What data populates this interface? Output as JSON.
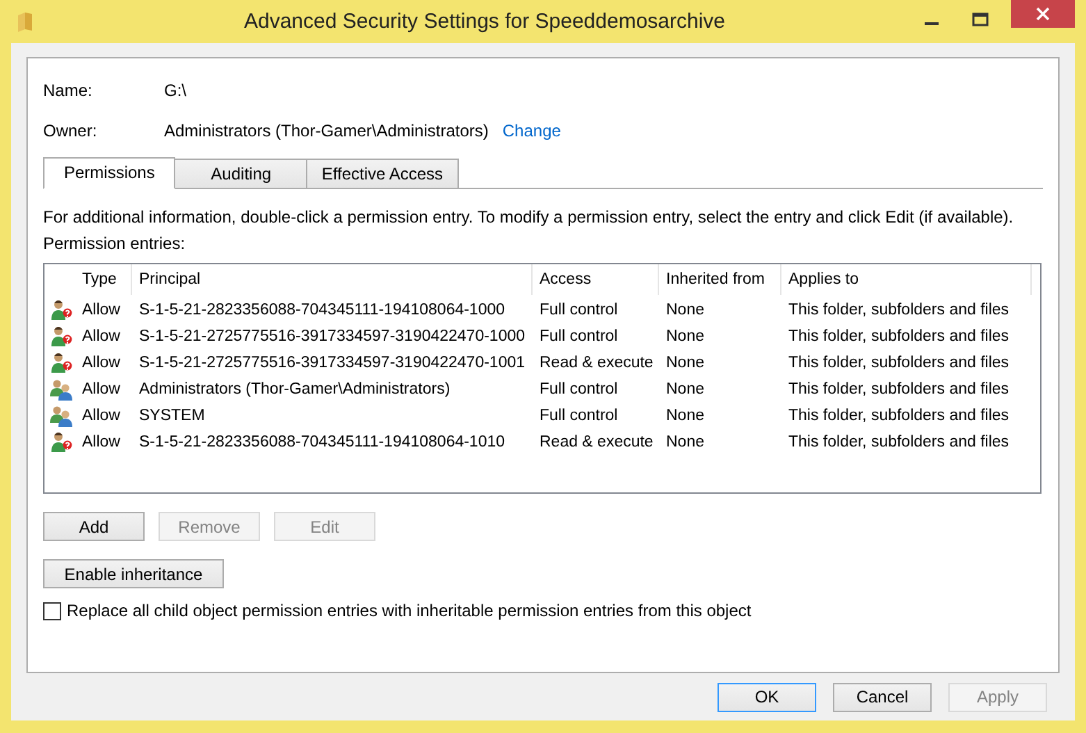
{
  "window": {
    "title": "Advanced Security Settings for Speeddemosarchive"
  },
  "name": {
    "label": "Name:",
    "value": "G:\\"
  },
  "owner": {
    "label": "Owner:",
    "value": "Administrators (Thor-Gamer\\Administrators)",
    "link": "Change"
  },
  "tabs": [
    {
      "label": "Permissions",
      "selected": true
    },
    {
      "label": "Auditing",
      "selected": false
    },
    {
      "label": "Effective Access",
      "selected": false
    }
  ],
  "info": "For additional information, double-click a permission entry. To modify a permission entry, select the entry and click Edit (if available).",
  "entries_label": "Permission entries:",
  "table": {
    "columns": [
      "Type",
      "Principal",
      "Access",
      "Inherited from",
      "Applies to"
    ],
    "rows": [
      {
        "kind": "unknown-user",
        "type": "Allow",
        "principal": "S-1-5-21-2823356088-704345111-194108064-1000",
        "access": "Full control",
        "inherited": "None",
        "applies": "This folder, subfolders and files"
      },
      {
        "kind": "unknown-user",
        "type": "Allow",
        "principal": "S-1-5-21-2725775516-3917334597-3190422470-1000",
        "access": "Full control",
        "inherited": "None",
        "applies": "This folder, subfolders and files"
      },
      {
        "kind": "unknown-user",
        "type": "Allow",
        "principal": "S-1-5-21-2725775516-3917334597-3190422470-1001",
        "access": "Read & execute",
        "inherited": "None",
        "applies": "This folder, subfolders and files"
      },
      {
        "kind": "group",
        "type": "Allow",
        "principal": "Administrators (Thor-Gamer\\Administrators)",
        "access": "Full control",
        "inherited": "None",
        "applies": "This folder, subfolders and files"
      },
      {
        "kind": "group",
        "type": "Allow",
        "principal": "SYSTEM",
        "access": "Full control",
        "inherited": "None",
        "applies": "This folder, subfolders and files"
      },
      {
        "kind": "unknown-user",
        "type": "Allow",
        "principal": "S-1-5-21-2823356088-704345111-194108064-1010",
        "access": "Read & execute",
        "inherited": "None",
        "applies": "This folder, subfolders and files"
      }
    ]
  },
  "entry_buttons": [
    {
      "label": "Add",
      "disabled": false
    },
    {
      "label": "Remove",
      "disabled": true
    },
    {
      "label": "Edit",
      "disabled": true
    }
  ],
  "inheritance_button": "Enable inheritance",
  "replace_checkbox": {
    "label": "Replace all child object permission entries with inheritable permission entries from this object",
    "checked": false
  },
  "dialog_buttons": [
    {
      "label": "OK",
      "disabled": false,
      "default": true
    },
    {
      "label": "Cancel",
      "disabled": false,
      "default": false
    },
    {
      "label": "Apply",
      "disabled": true,
      "default": false
    }
  ]
}
